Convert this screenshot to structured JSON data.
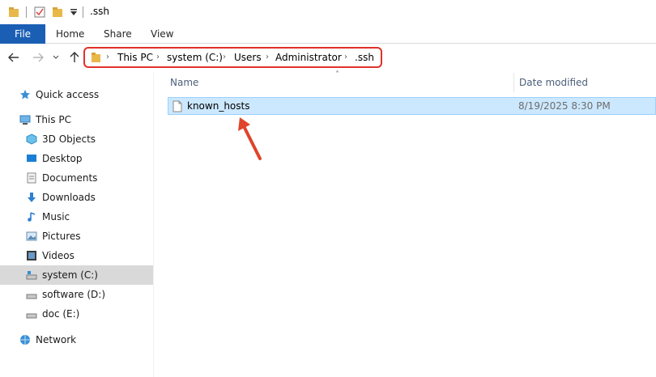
{
  "titlebar": {
    "title": ".ssh",
    "quick_access_icons": [
      "folder-icon",
      "checklist-icon",
      "folder-icon",
      "dropdown-arrow-icon"
    ]
  },
  "ribbon": {
    "file": "File",
    "tabs": [
      "Home",
      "Share",
      "View"
    ]
  },
  "address": {
    "breadcrumbs": [
      "This PC",
      "system (C:)",
      "Users",
      "Administrator",
      ".ssh"
    ]
  },
  "sidebar": {
    "quick_access": "Quick access",
    "this_pc": "This PC",
    "items": [
      {
        "label": "3D Objects",
        "icon": "3d-objects-icon"
      },
      {
        "label": "Desktop",
        "icon": "desktop-icon"
      },
      {
        "label": "Documents",
        "icon": "documents-icon"
      },
      {
        "label": "Downloads",
        "icon": "downloads-icon"
      },
      {
        "label": "Music",
        "icon": "music-icon"
      },
      {
        "label": "Pictures",
        "icon": "pictures-icon"
      },
      {
        "label": "Videos",
        "icon": "videos-icon"
      },
      {
        "label": "system (C:)",
        "icon": "drive-icon",
        "selected": true
      },
      {
        "label": "software (D:)",
        "icon": "drive-icon"
      },
      {
        "label": "doc (E:)",
        "icon": "drive-icon"
      }
    ],
    "network": "Network"
  },
  "content": {
    "columns": [
      "Name",
      "Date modified"
    ],
    "files": [
      {
        "name": "known_hosts",
        "date_modified": "8/19/2025 8:30 PM",
        "selected": true
      }
    ]
  },
  "colors": {
    "file_tab": "#1a5fb4",
    "highlight_border": "#e0322a",
    "selection_bg": "#cce8ff"
  }
}
